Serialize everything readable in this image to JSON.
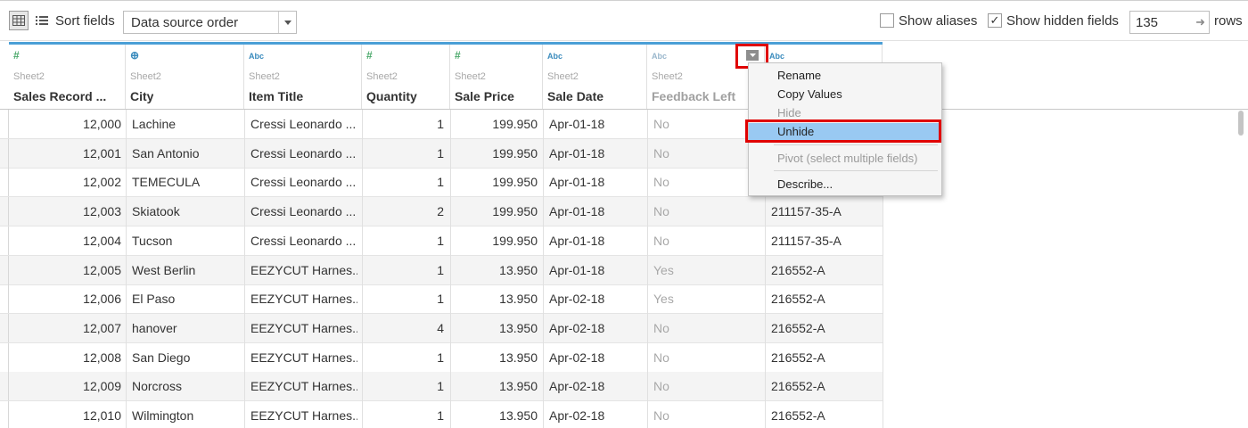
{
  "toolbar": {
    "sort_label": "Sort fields",
    "sort_value": "Data source order",
    "show_aliases_label": "Show aliases",
    "show_aliases_checked": false,
    "show_hidden_label": "Show hidden fields",
    "show_hidden_checked": true,
    "rows_value": "135",
    "rows_label": "rows"
  },
  "columns": [
    {
      "type": "#",
      "source": "Sheet2",
      "name": "Sales Record ..."
    },
    {
      "type": "⊕",
      "source": "Sheet2",
      "name": "City"
    },
    {
      "type": "Abc",
      "source": "Sheet2",
      "name": "Item Title"
    },
    {
      "type": "#",
      "source": "Sheet2",
      "name": "Quantity"
    },
    {
      "type": "#",
      "source": "Sheet2",
      "name": "Sale Price"
    },
    {
      "type": "Abc",
      "source": "Sheet2",
      "name": "Sale Date"
    },
    {
      "type": "Abc",
      "source": "Sheet2",
      "name": "Feedback Left"
    },
    {
      "type": "Abc",
      "source": "",
      "name": ""
    }
  ],
  "rows": [
    [
      "12,000",
      "Lachine",
      "Cressi Leonardo ...",
      "1",
      "199.950",
      "Apr-01-18",
      "No",
      ""
    ],
    [
      "12,001",
      "San Antonio",
      "Cressi Leonardo ...",
      "1",
      "199.950",
      "Apr-01-18",
      "No",
      ""
    ],
    [
      "12,002",
      "TEMECULA",
      "Cressi Leonardo ...",
      "1",
      "199.950",
      "Apr-01-18",
      "No",
      ""
    ],
    [
      "12,003",
      "Skiatook",
      "Cressi Leonardo ...",
      "2",
      "199.950",
      "Apr-01-18",
      "No",
      "211157-35-A"
    ],
    [
      "12,004",
      "Tucson",
      "Cressi Leonardo ...",
      "1",
      "199.950",
      "Apr-01-18",
      "No",
      "211157-35-A"
    ],
    [
      "12,005",
      "West Berlin",
      "EEZYCUT Harnes...",
      "1",
      "13.950",
      "Apr-01-18",
      "Yes",
      "216552-A"
    ],
    [
      "12,006",
      "El Paso",
      "EEZYCUT Harnes...",
      "1",
      "13.950",
      "Apr-02-18",
      "Yes",
      "216552-A"
    ],
    [
      "12,007",
      "hanover",
      "EEZYCUT Harnes...",
      "4",
      "13.950",
      "Apr-02-18",
      "No",
      "216552-A"
    ],
    [
      "12,008",
      "San Diego",
      "EEZYCUT Harnes...",
      "1",
      "13.950",
      "Apr-02-18",
      "No",
      "216552-A"
    ],
    [
      "12,009",
      "Norcross",
      "EEZYCUT Harnes...",
      "1",
      "13.950",
      "Apr-02-18",
      "No",
      "216552-A"
    ],
    [
      "12,010",
      "Wilmington",
      "EEZYCUT Harnes...",
      "1",
      "13.950",
      "Apr-02-18",
      "No",
      "216552-A"
    ]
  ],
  "menu": {
    "items": [
      {
        "label": "Rename",
        "state": "normal"
      },
      {
        "label": "Copy Values",
        "state": "normal"
      },
      {
        "label": "Hide",
        "state": "disabled"
      },
      {
        "label": "Unhide",
        "state": "active"
      },
      {
        "label": "Pivot (select multiple fields)",
        "state": "disabled"
      },
      {
        "label": "Describe...",
        "state": "normal"
      }
    ]
  },
  "colors": {
    "header_band": "#4a9fd6",
    "highlight": "#e00000",
    "menu_active": "#99c9f2"
  }
}
